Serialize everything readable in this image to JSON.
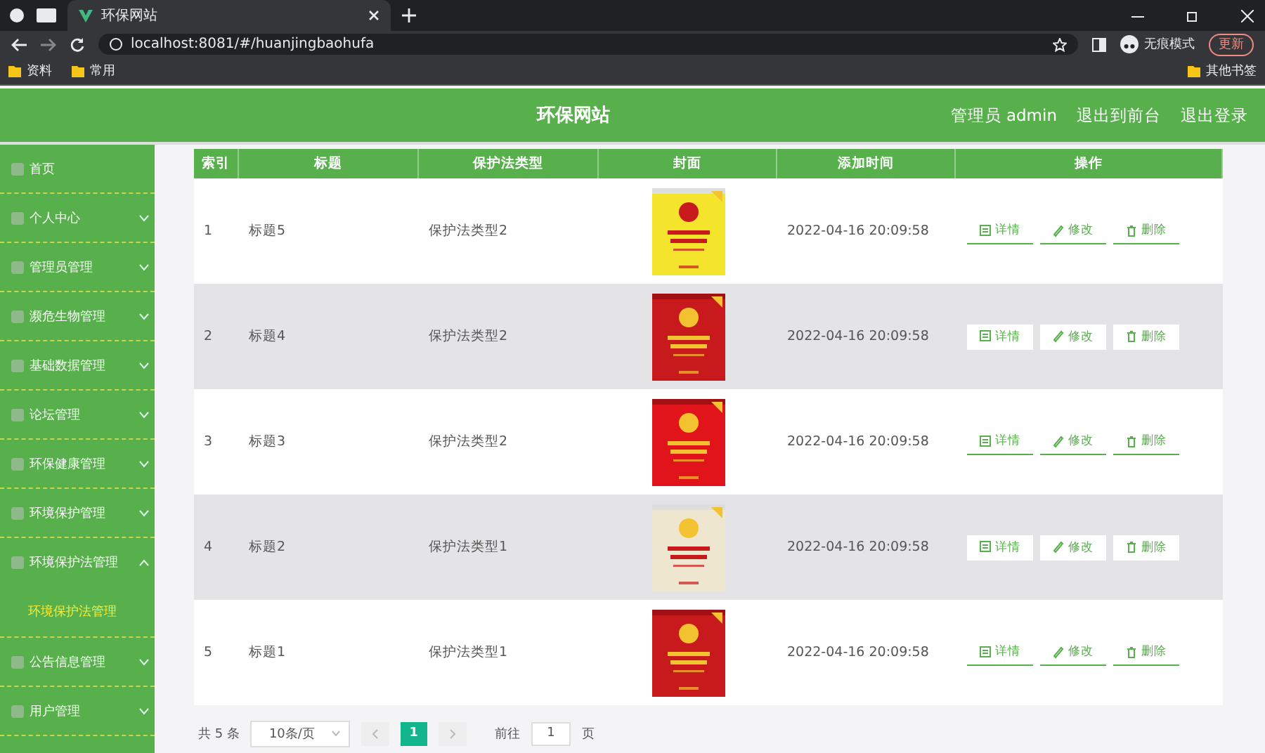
{
  "browser": {
    "tab_title": "环保网站",
    "url": "localhost:8081/#/huanjingbaohufa",
    "profile": "无痕模式",
    "update_button": "更新",
    "bookmarks": [
      {
        "label": "资料"
      },
      {
        "label": "常用"
      }
    ],
    "other_bookmarks": "其他书签"
  },
  "header": {
    "title": "环保网站",
    "links": [
      "管理员 admin",
      "退出到前台",
      "退出登录"
    ]
  },
  "sidebar": {
    "items": [
      {
        "label": "首页",
        "expandable": false,
        "expanded": false
      },
      {
        "label": "个人中心",
        "expandable": true,
        "expanded": false
      },
      {
        "label": "管理员管理",
        "expandable": true,
        "expanded": false
      },
      {
        "label": "濒危生物管理",
        "expandable": true,
        "expanded": false
      },
      {
        "label": "基础数据管理",
        "expandable": true,
        "expanded": false
      },
      {
        "label": "论坛管理",
        "expandable": true,
        "expanded": false
      },
      {
        "label": "环保健康管理",
        "expandable": true,
        "expanded": false
      },
      {
        "label": "环境保护管理",
        "expandable": true,
        "expanded": false
      },
      {
        "label": "环境保护法管理",
        "expandable": true,
        "expanded": true,
        "children": [
          {
            "label": "环境保护法管理",
            "selected": true
          }
        ]
      },
      {
        "label": "公告信息管理",
        "expandable": true,
        "expanded": false
      },
      {
        "label": "用户管理",
        "expandable": true,
        "expanded": false
      }
    ]
  },
  "table": {
    "columns": [
      "索引",
      "标题",
      "保护法类型",
      "封面",
      "添加时间",
      "操作"
    ],
    "rows": [
      {
        "index": "1",
        "title": "标题5",
        "type": "保护法类型2",
        "time": "2022-04-16 20:09:58",
        "highlighted": false,
        "actions": [
          "详情",
          "修改",
          "删除"
        ]
      },
      {
        "index": "2",
        "title": "标题4",
        "type": "保护法类型2",
        "time": "2022-04-16 20:09:58",
        "highlighted": true,
        "actions": [
          "详情",
          "修改",
          "删除"
        ]
      },
      {
        "index": "3",
        "title": "标题3",
        "type": "保护法类型2",
        "time": "2022-04-16 20:09:58",
        "highlighted": false,
        "actions": [
          "详情",
          "修改",
          "删除"
        ]
      },
      {
        "index": "4",
        "title": "标题2",
        "type": "保护法类型1",
        "time": "2022-04-16 20:09:58",
        "highlighted": true,
        "actions": [
          "详情",
          "修改",
          "删除"
        ]
      },
      {
        "index": "5",
        "title": "标题1",
        "type": "保护法类型1",
        "time": "2022-04-16 20:09:58",
        "highlighted": false,
        "actions": [
          "详情",
          "修改",
          "删除"
        ]
      }
    ]
  },
  "pagination": {
    "total": "共 5 条",
    "page_size": "10条/页",
    "pages": [
      {
        "label": "1",
        "selected": true
      }
    ],
    "goto_label": "前往",
    "goto_value": "1",
    "goto_suffix": "页"
  }
}
